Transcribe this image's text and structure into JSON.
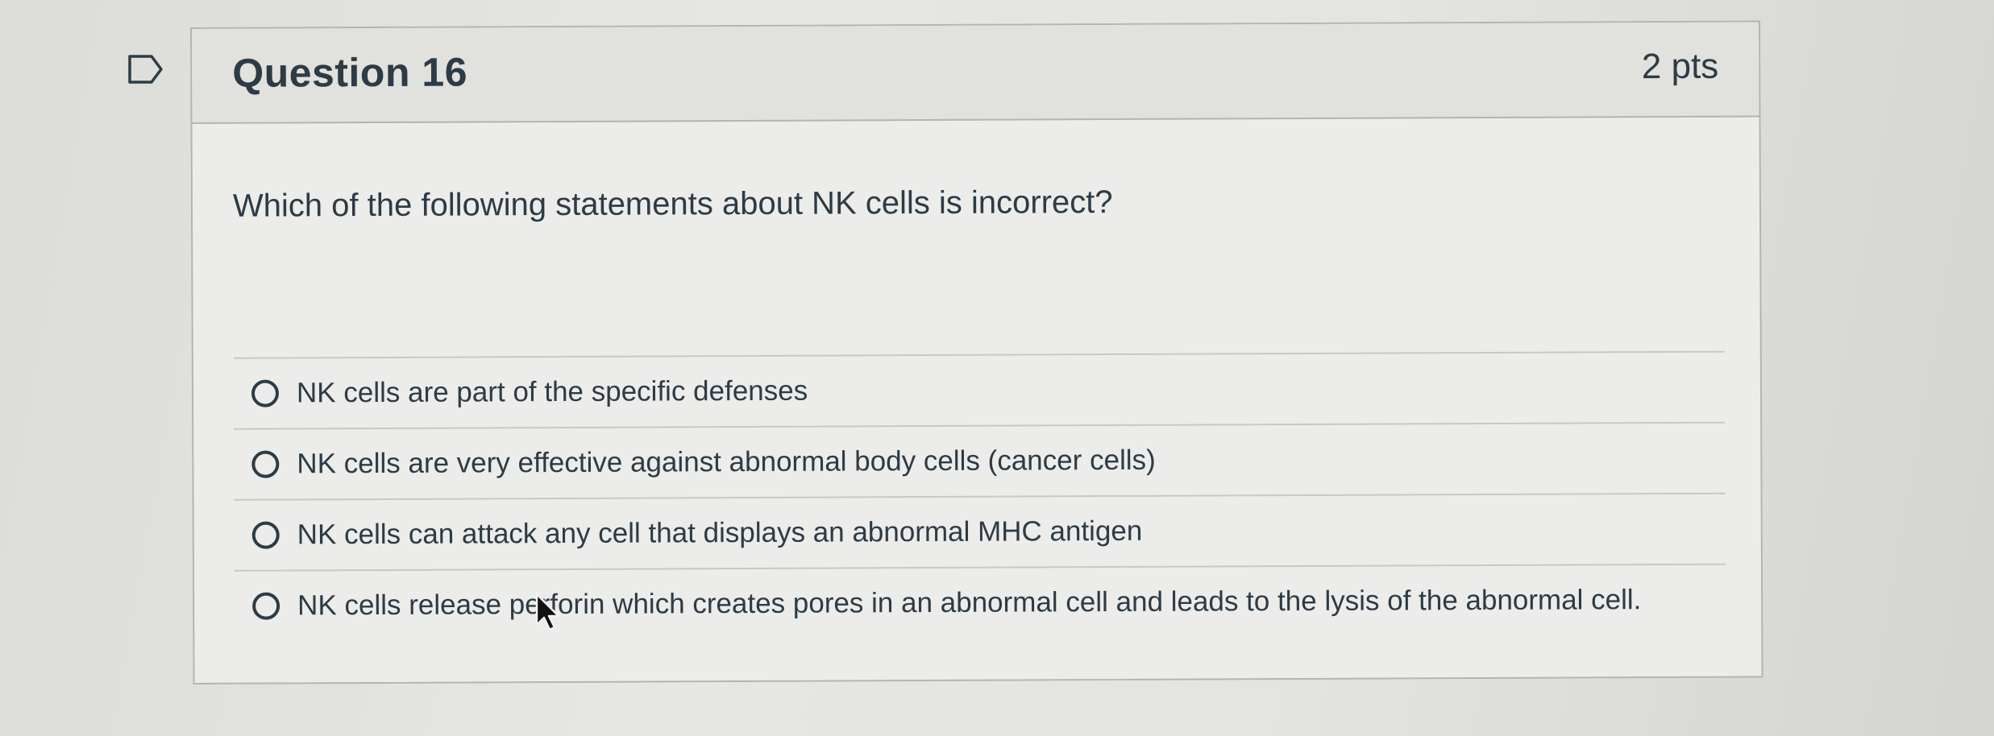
{
  "question": {
    "title": "Question 16",
    "points": "2 pts",
    "text": "Which of the following statements about NK cells is incorrect?",
    "flag_icon": "flag-outline-icon"
  },
  "answers": [
    {
      "label": "NK cells are part of the specific defenses",
      "selected": false
    },
    {
      "label": "NK cells are very effective against abnormal body cells (cancer cells)",
      "selected": false
    },
    {
      "label": "NK cells can attack any cell that displays an abnormal MHC antigen",
      "selected": false
    },
    {
      "label": "NK cells release perforin which creates pores in an abnormal cell and leads to the lysis of the abnormal cell.",
      "selected": false
    }
  ],
  "colors": {
    "text": "#2d3b45",
    "border": "#b4b4b0",
    "header_bg": "#e1e1dd"
  }
}
